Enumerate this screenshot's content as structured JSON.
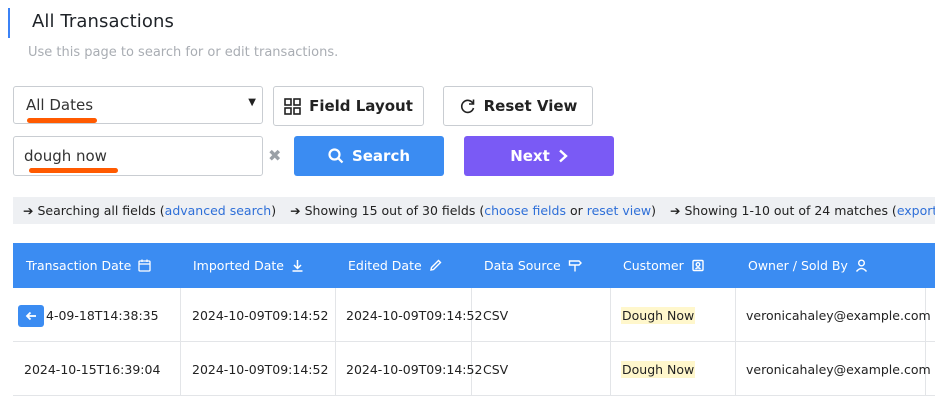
{
  "header": {
    "title": "All Transactions",
    "subtitle": "Use this page to search for or edit transactions."
  },
  "filters": {
    "date_select_value": "All Dates",
    "field_layout_label": "Field Layout",
    "reset_view_label": "Reset View",
    "search_value": "dough now",
    "clear_symbol": "✖",
    "search_label": "Search",
    "next_label": "Next"
  },
  "info_bar": {
    "seg1_text": "Searching all fields (",
    "seg1_link": "advanced search",
    "seg1_end": ")",
    "seg2_text": "Showing 15 out of 30 fields (",
    "seg2_link1": "choose fields",
    "seg2_mid": " or ",
    "seg2_link2": "reset view",
    "seg2_end": ")",
    "seg3_text": "Showing 1-10 out of 24 matches (",
    "seg3_link": "export"
  },
  "table": {
    "columns": [
      "Transaction Date",
      "Imported Date",
      "Edited Date",
      "Data Source",
      "Customer",
      "Owner / Sold By"
    ],
    "rows": [
      [
        "4-09-18T14:38:35",
        "2024-10-09T09:14:52",
        "2024-10-09T09:14:52",
        "CSV",
        "Dough Now",
        "veronicahaley@example.com"
      ],
      [
        "2024-10-15T16:39:04",
        "2024-10-09T09:14:52",
        "2024-10-09T09:14:52",
        "CSV",
        "Dough Now",
        "veronicahaley@example.com"
      ]
    ]
  },
  "colors": {
    "accent_blue": "#3b8cf2",
    "next_purple": "#7a5af5",
    "highlight": "#fff7cc",
    "annotation_red": "#ff5a00"
  }
}
